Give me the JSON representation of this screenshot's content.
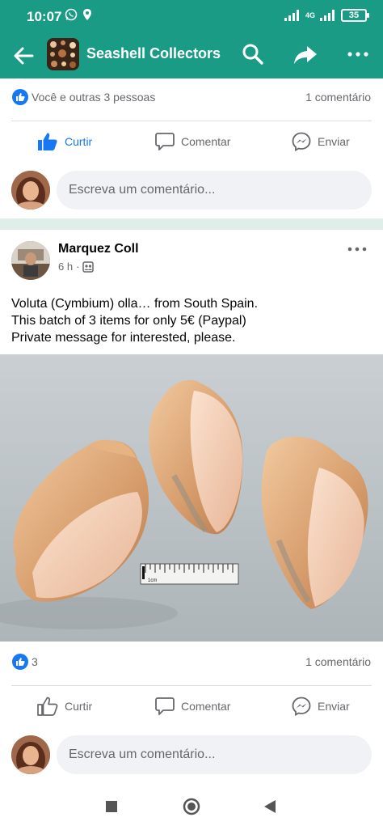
{
  "status_bar": {
    "time": "10:07",
    "network": "4G",
    "battery": "35"
  },
  "app_bar": {
    "title": "Seashell Collectors"
  },
  "prev_post": {
    "reactions_text": "Você e outras 3 pessoas",
    "comments_text": "1 comentário",
    "actions": {
      "like": "Curtir",
      "comment": "Comentar",
      "send": "Enviar"
    },
    "comment_placeholder": "Escreva um comentário..."
  },
  "post": {
    "author": "Marquez Coll",
    "time": "6 h",
    "text_lines": [
      "Voluta (Cymbium) olla… from South Spain.",
      "This batch of 3 items for only 5€ (Paypal)",
      "Private message for interested, please."
    ],
    "image_scale_label": "1cm",
    "reactions_count": "3",
    "comments_text": "1 comentário",
    "actions": {
      "like": "Curtir",
      "comment": "Comentar",
      "send": "Enviar"
    },
    "comment_placeholder": "Escreva um comentário..."
  },
  "icons": {
    "back": "arrow-left-icon",
    "search": "search-icon",
    "share": "share-icon",
    "more": "more-dots-icon"
  },
  "colors": {
    "brand_teal": "#1a9b86",
    "facebook_blue": "#1877f2",
    "muted_text": "#65676b",
    "input_bg": "#f0f2f5"
  }
}
